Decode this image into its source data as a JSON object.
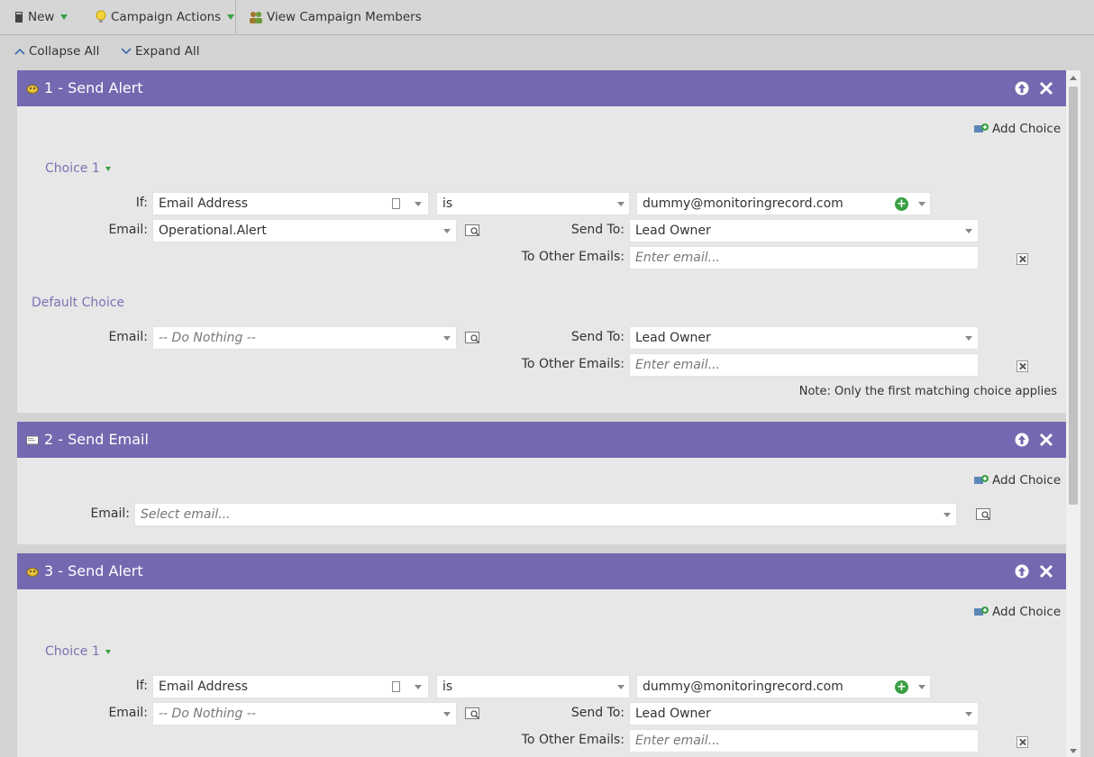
{
  "toolbar": {
    "new_label": "New",
    "campaign_actions_label": "Campaign Actions",
    "view_members_label": "View Campaign Members"
  },
  "subbar": {
    "collapse_label": "Collapse All",
    "expand_label": "Expand All"
  },
  "steps": [
    {
      "title": "1 - Send Alert",
      "add_choice_label": "Add Choice",
      "choice": {
        "label": "Choice 1",
        "if_label": "If:",
        "attribute": "Email Address",
        "operator": "is",
        "value": "dummy@monitoringrecord.com",
        "email_label": "Email:",
        "email_value": "Operational.Alert",
        "send_to_label": "Send To:",
        "send_to_value": "Lead Owner",
        "other_emails_label": "To Other Emails:",
        "other_emails_placeholder": "Enter email..."
      },
      "default": {
        "label": "Default Choice",
        "email_label": "Email:",
        "email_value": "-- Do Nothing --",
        "send_to_label": "Send To:",
        "send_to_value": "Lead Owner",
        "other_emails_label": "To Other Emails:",
        "other_emails_placeholder": "Enter email..."
      },
      "note": "Note: Only the first matching choice applies"
    },
    {
      "title": "2 - Send Email",
      "add_choice_label": "Add Choice",
      "email_label": "Email:",
      "email_placeholder": "Select email..."
    },
    {
      "title": "3 - Send Alert",
      "add_choice_label": "Add Choice",
      "choice": {
        "label": "Choice 1",
        "if_label": "If:",
        "attribute": "Email Address",
        "operator": "is",
        "value": "dummy@monitoringrecord.com",
        "email_label": "Email:",
        "email_value": "-- Do Nothing --",
        "send_to_label": "Send To:",
        "send_to_value": "Lead Owner",
        "other_emails_label": "To Other Emails:",
        "other_emails_placeholder": "Enter email..."
      }
    }
  ],
  "colors": {
    "header": "#7269b0",
    "choice_label": "#7a73b3",
    "accent_green": "#3aa043"
  }
}
